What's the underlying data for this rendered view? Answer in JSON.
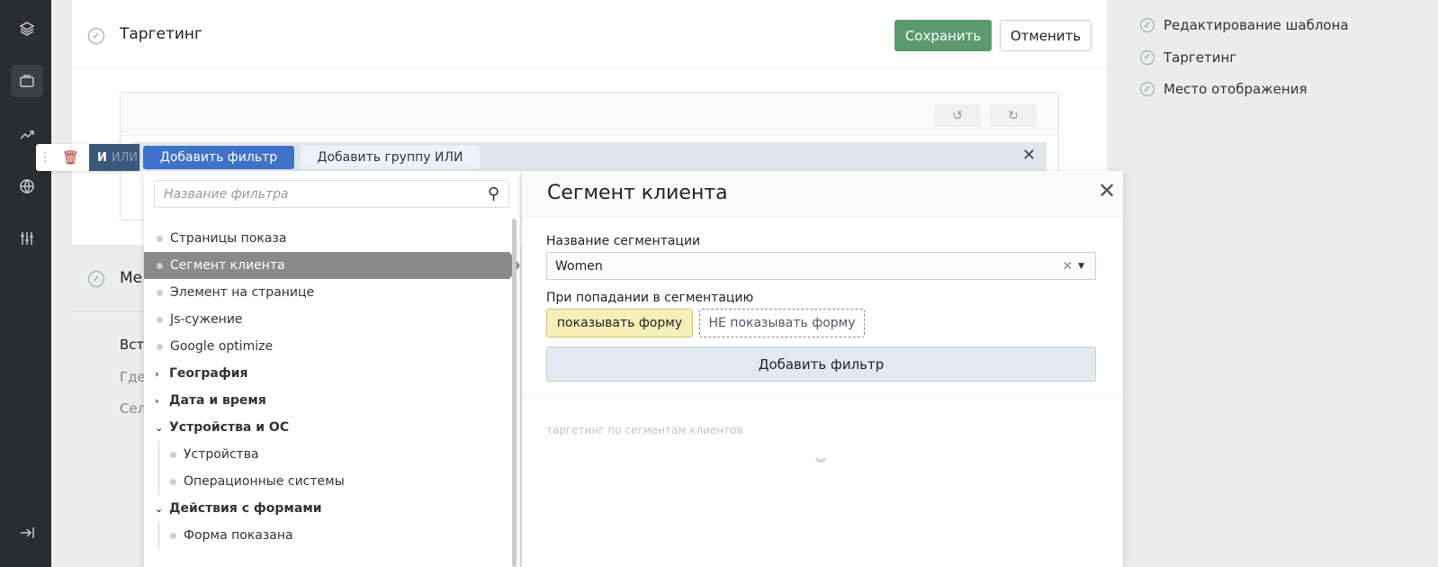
{
  "sidebar": {
    "icons": [
      "layers-icon",
      "briefcase-icon",
      "trending-icon",
      "globe-icon",
      "sliders-icon",
      "logout-icon"
    ],
    "active": "briefcase-icon"
  },
  "section": {
    "title": "Таргетинг",
    "save": "Сохранить",
    "cancel": "Отменить"
  },
  "second_section": {
    "title": "Ме",
    "lines": [
      "Вст",
      "Где",
      "Сел"
    ]
  },
  "filterbar": {
    "and": "И",
    "or": "ИЛИ",
    "add_filter": "Добавить фильтр",
    "add_group": "Добавить группу ИЛИ"
  },
  "filter_list": {
    "search_placeholder": "Название фильтра",
    "items": [
      {
        "label": "Страницы показа",
        "type": "item"
      },
      {
        "label": "Сегмент клиента",
        "type": "item",
        "selected": true
      },
      {
        "label": "Элемент на странице",
        "type": "item"
      },
      {
        "label": "Js-сужение",
        "type": "item"
      },
      {
        "label": "Google optimize",
        "type": "item"
      },
      {
        "label": "География",
        "type": "group",
        "expanded": false
      },
      {
        "label": "Дата и время",
        "type": "group",
        "expanded": false
      },
      {
        "label": "Устройства и ОС",
        "type": "group",
        "expanded": true
      },
      {
        "label": "Устройства",
        "type": "sub"
      },
      {
        "label": "Операционные системы",
        "type": "sub"
      },
      {
        "label": "Действия с формами",
        "type": "group",
        "expanded": true
      },
      {
        "label": "Форма показана",
        "type": "sub"
      }
    ]
  },
  "detail": {
    "title": "Сегмент клиента",
    "seg_label": "Название сегментации",
    "seg_value": "Women",
    "hit_label": "При попадании в сегментацию",
    "show": "показывать форму",
    "hide": "НЕ показывать форму",
    "add_filter": "Добавить фильтр",
    "hint": "таргетинг по сегментам клиентов"
  },
  "right_panel": {
    "items": [
      "Редактирование шаблона",
      "Таргетинг",
      "Место отображения"
    ]
  },
  "colors": {
    "save": "#5a9a6e",
    "add_filter": "#3f73c9",
    "and_or": "#3a5878",
    "selected_item": "#8a8a8a",
    "show_active": "#f6f0b8"
  }
}
